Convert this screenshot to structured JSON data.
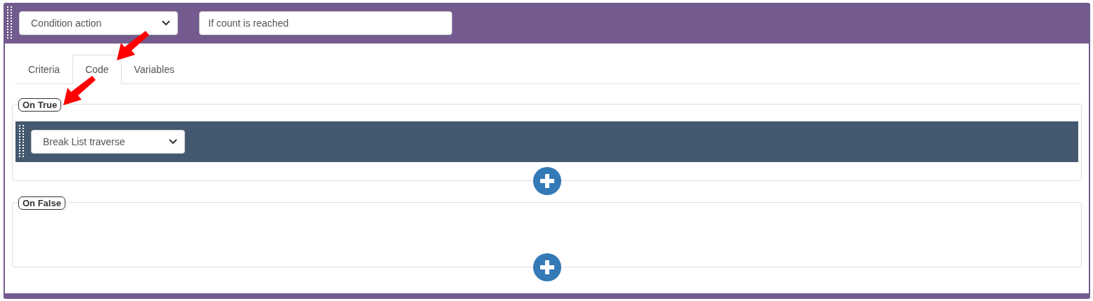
{
  "header": {
    "action_select": {
      "value": "Condition action"
    },
    "description_field": {
      "value": "If count is reached"
    }
  },
  "tabs": [
    {
      "label": "Criteria",
      "selected": false
    },
    {
      "label": "Code",
      "selected": true
    },
    {
      "label": "Variables",
      "selected": false
    }
  ],
  "branches": [
    {
      "legend": "On True",
      "steps": [
        {
          "value": "Break List traverse"
        }
      ]
    },
    {
      "legend": "On False"
    }
  ],
  "annotations": [
    {
      "kind": "arrow"
    },
    {
      "kind": "arrow"
    }
  ]
}
